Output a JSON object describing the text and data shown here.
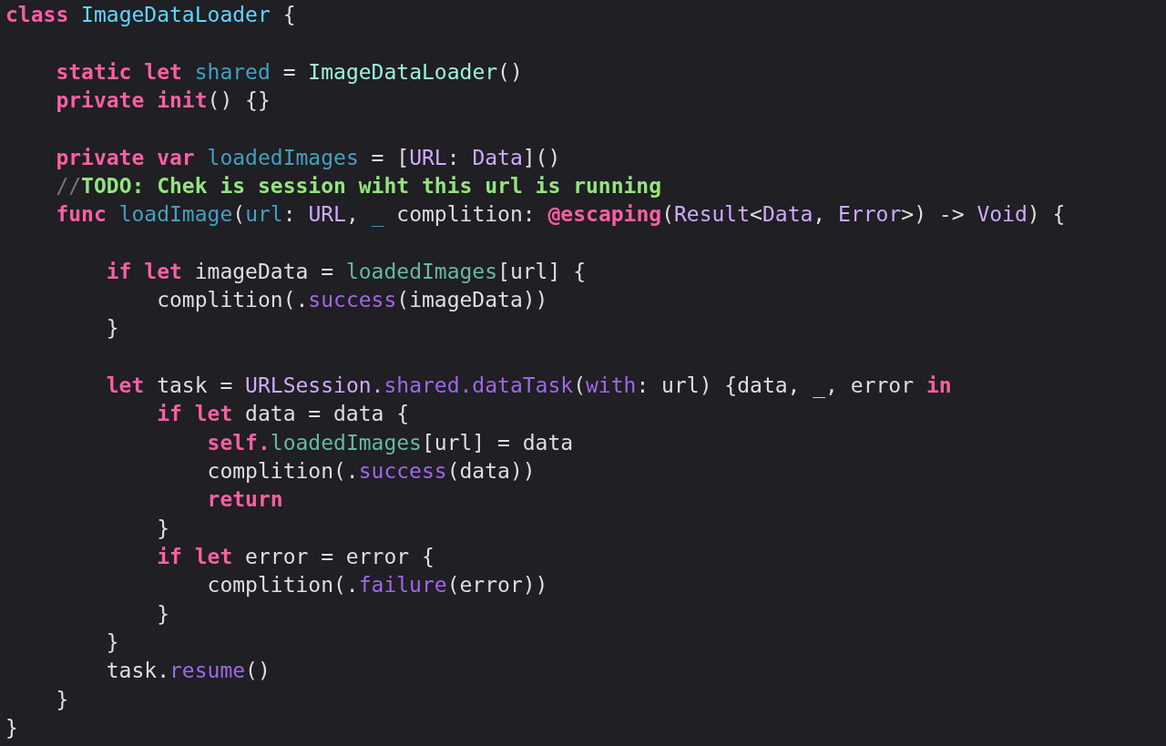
{
  "editor": {
    "lines": [
      {
        "kind": "code",
        "tokens": [
          {
            "text": "class",
            "kind": "keyword"
          },
          {
            "text": " ImageDataLoader",
            "kind": "typedecl"
          },
          {
            "text": " {"
          }
        ]
      },
      {
        "kind": "blank"
      },
      {
        "kind": "code",
        "tokens": [
          {
            "text": "    static let",
            "kind": "keyword"
          },
          {
            "text": " shared",
            "kind": "propdecl"
          },
          {
            "text": " ="
          },
          {
            "text": " ImageDataLoader",
            "kind": "typeref"
          },
          {
            "text": "()"
          }
        ]
      },
      {
        "kind": "code",
        "tokens": [
          {
            "text": "    private init",
            "kind": "keyword"
          },
          {
            "text": "() {}"
          }
        ]
      },
      {
        "kind": "blank"
      },
      {
        "kind": "code",
        "tokens": [
          {
            "text": "    private var",
            "kind": "keyword"
          },
          {
            "text": " loadedImages",
            "kind": "propdecl"
          },
          {
            "text": " = ["
          },
          {
            "text": "URL",
            "kind": "systype"
          },
          {
            "text": ": "
          },
          {
            "text": "Data",
            "kind": "systype"
          },
          {
            "text": "]()"
          }
        ]
      },
      {
        "kind": "code",
        "tokens": [
          {
            "text": "    //",
            "kind": "comment"
          },
          {
            "text": "TODO: Chek is session wiht this url is running",
            "kind": "mark"
          }
        ]
      },
      {
        "kind": "code",
        "tokens": [
          {
            "text": "    func",
            "kind": "keyword"
          },
          {
            "text": " loadImage",
            "kind": "propdecl"
          },
          {
            "text": "("
          },
          {
            "text": "url",
            "kind": "propdecl"
          },
          {
            "text": ": "
          },
          {
            "text": "URL",
            "kind": "systype"
          },
          {
            "text": ", "
          },
          {
            "text": "_",
            "kind": "propdecl"
          },
          {
            "text": " complition: "
          },
          {
            "text": "@escaping",
            "kind": "keyword"
          },
          {
            "text": "("
          },
          {
            "text": "Result",
            "kind": "systype"
          },
          {
            "text": "<"
          },
          {
            "text": "Data",
            "kind": "systype"
          },
          {
            "text": ", "
          },
          {
            "text": "Error",
            "kind": "systype"
          },
          {
            "text": ">) -> "
          },
          {
            "text": "Void",
            "kind": "systype"
          },
          {
            "text": ") {"
          }
        ]
      },
      {
        "kind": "blank"
      },
      {
        "kind": "code",
        "tokens": [
          {
            "text": "        if let",
            "kind": "keyword"
          },
          {
            "text": " imageData = "
          },
          {
            "text": "loadedImages",
            "kind": "propref"
          },
          {
            "text": "[url] {"
          }
        ]
      },
      {
        "kind": "code",
        "tokens": [
          {
            "text": "            complition(."
          },
          {
            "text": "success",
            "kind": "sysmember"
          },
          {
            "text": "(imageData))"
          }
        ]
      },
      {
        "kind": "code",
        "tokens": [
          {
            "text": "        }"
          }
        ]
      },
      {
        "kind": "blank"
      },
      {
        "kind": "code",
        "tokens": [
          {
            "text": "        let",
            "kind": "keyword"
          },
          {
            "text": " task = "
          },
          {
            "text": "URLSession.",
            "kind": "systype"
          },
          {
            "text": "shared.dataTask",
            "kind": "sysmember"
          },
          {
            "text": "("
          },
          {
            "text": "with",
            "kind": "sysmember"
          },
          {
            "text": ": url) {data, _, error "
          },
          {
            "text": "in",
            "kind": "keyword"
          }
        ]
      },
      {
        "kind": "code",
        "tokens": [
          {
            "text": "            if let",
            "kind": "keyword"
          },
          {
            "text": " data = data {"
          }
        ]
      },
      {
        "kind": "code",
        "tokens": [
          {
            "text": "                self.",
            "kind": "keyword"
          },
          {
            "text": "loadedImages",
            "kind": "propref"
          },
          {
            "text": "[url] = data"
          }
        ]
      },
      {
        "kind": "code",
        "tokens": [
          {
            "text": "                complition(."
          },
          {
            "text": "success",
            "kind": "sysmember"
          },
          {
            "text": "(data))"
          }
        ]
      },
      {
        "kind": "code",
        "tokens": [
          {
            "text": "                return",
            "kind": "keyword"
          }
        ]
      },
      {
        "kind": "code",
        "tokens": [
          {
            "text": "            }"
          }
        ]
      },
      {
        "kind": "code",
        "tokens": [
          {
            "text": "            if let",
            "kind": "keyword"
          },
          {
            "text": " error = error {"
          }
        ]
      },
      {
        "kind": "code",
        "tokens": [
          {
            "text": "                complition(."
          },
          {
            "text": "failure",
            "kind": "sysmember"
          },
          {
            "text": "(error))"
          }
        ]
      },
      {
        "kind": "code",
        "tokens": [
          {
            "text": "            }"
          }
        ]
      },
      {
        "kind": "code",
        "tokens": [
          {
            "text": "        }"
          }
        ]
      },
      {
        "kind": "code",
        "tokens": [
          {
            "text": "        task."
          },
          {
            "text": "resume",
            "kind": "sysmember"
          },
          {
            "text": "()"
          }
        ]
      },
      {
        "kind": "code",
        "tokens": [
          {
            "text": "    }"
          }
        ]
      },
      {
        "kind": "code",
        "tokens": [
          {
            "text": "}"
          }
        ]
      }
    ]
  }
}
